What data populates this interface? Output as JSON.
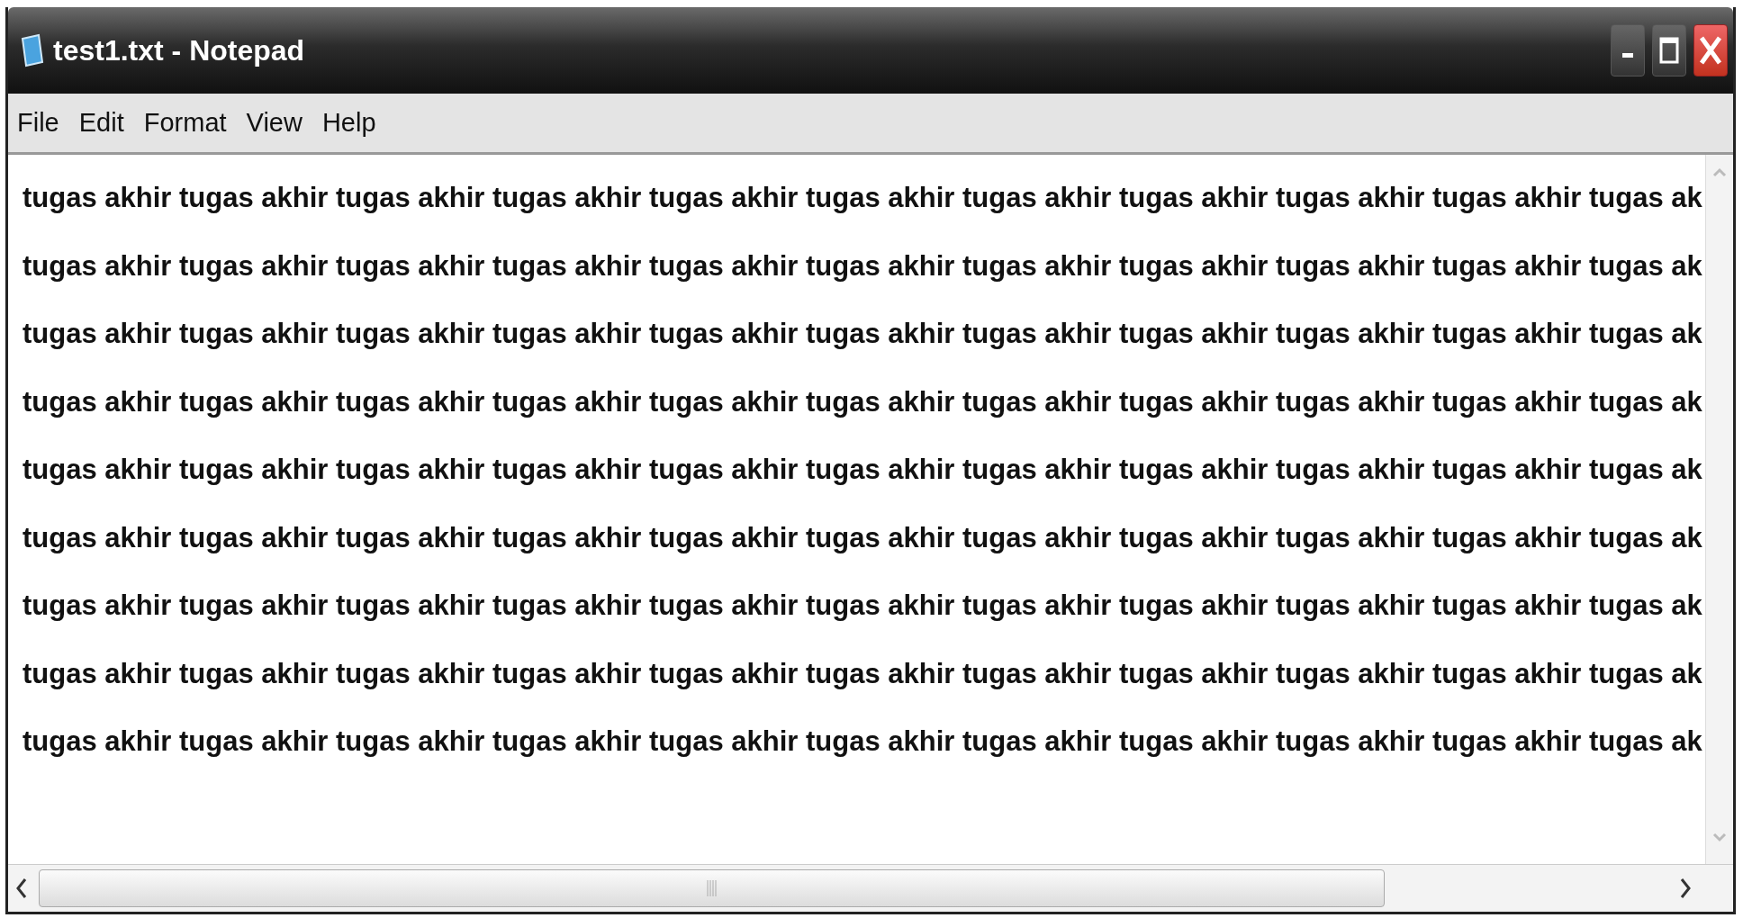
{
  "window": {
    "title": "test1.txt - Notepad"
  },
  "menu": [
    "File",
    "Edit",
    "Format",
    "View",
    "Help"
  ],
  "document": {
    "lines": [
      "tugas akhir tugas akhir tugas akhir tugas akhir tugas akhir tugas akhir tugas akhir tugas akhir tugas akhir tugas akhir tugas ak",
      "tugas akhir tugas akhir tugas akhir tugas akhir tugas akhir tugas akhir tugas akhir tugas akhir tugas akhir tugas akhir tugas ak",
      "tugas akhir tugas akhir tugas akhir tugas akhir tugas akhir tugas akhir tugas akhir tugas akhir tugas akhir tugas akhir tugas ak",
      "tugas akhir tugas akhir tugas akhir tugas akhir tugas akhir tugas akhir tugas akhir tugas akhir tugas akhir tugas akhir tugas ak",
      "tugas akhir tugas akhir tugas akhir tugas akhir tugas akhir tugas akhir tugas akhir tugas akhir tugas akhir tugas akhir tugas ak",
      "tugas akhir tugas akhir tugas akhir tugas akhir tugas akhir tugas akhir tugas akhir tugas akhir tugas akhir tugas akhir tugas ak",
      "tugas akhir tugas akhir tugas akhir tugas akhir tugas akhir tugas akhir tugas akhir tugas akhir tugas akhir tugas akhir tugas ak",
      "tugas akhir tugas akhir tugas akhir tugas akhir tugas akhir tugas akhir tugas akhir tugas akhir tugas akhir tugas akhir tugas ak",
      "tugas akhir tugas akhir tugas akhir tugas akhir tugas akhir tugas akhir tugas akhir tugas akhir tugas akhir tugas akhir tugas ak"
    ]
  }
}
